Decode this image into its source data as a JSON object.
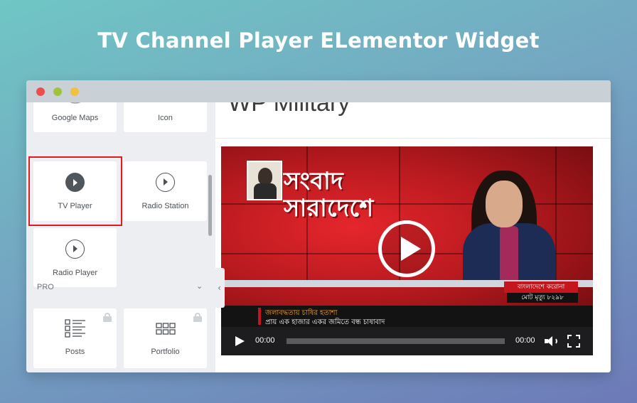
{
  "headline": "TV Channel Player ELementor Widget",
  "window": {
    "traffic_lights": [
      "close",
      "minimize",
      "zoom"
    ],
    "colors": {
      "close": "#ea4f4f",
      "minimize": "#9fc33d",
      "zoom": "#f3c03f"
    }
  },
  "panel": {
    "widgets": [
      {
        "label": "Google Maps",
        "icon": "map-icon"
      },
      {
        "label": "Icon",
        "icon": "star-icon"
      },
      {
        "label": "TV Player",
        "icon": "play-circle-filled-icon",
        "highlighted": true
      },
      {
        "label": "Radio Station",
        "icon": "play-circle-outline-icon"
      },
      {
        "label": "Radio Player",
        "icon": "play-circle-outline-icon"
      }
    ],
    "pro_section": {
      "label": "PRO",
      "items": [
        {
          "label": "Posts",
          "icon": "posts-list-icon",
          "locked": true
        },
        {
          "label": "Portfolio",
          "icon": "portfolio-grid-icon",
          "locked": true
        }
      ]
    },
    "highlight_color": "#e11b22"
  },
  "content": {
    "site_title": "WP Military",
    "player": {
      "channel_logo_line1": "সংবাদ",
      "channel_logo_line2": "সারাদেশে",
      "lower_third_tag": "বাংলাদেশে করোনা",
      "lower_third_sub": "মোট মৃত্যু ৮২৯৮",
      "ticker_line1": "জলাবদ্ধতায় চাষির হতাশা",
      "ticker_line2": "প্রায় এক হাজার একর জমিতে বন্ধ চাষাবাদ",
      "current_time": "00:00",
      "duration": "00:00",
      "progress": 0
    }
  }
}
